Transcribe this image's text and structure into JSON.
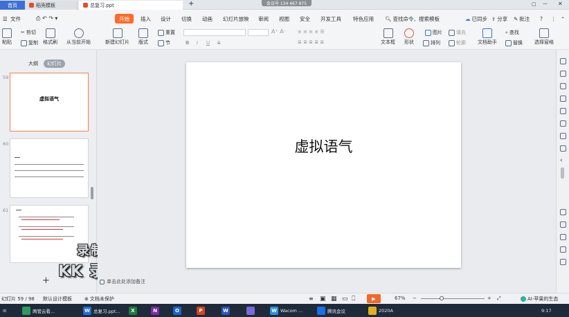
{
  "titlebar": {
    "tabs": [
      {
        "label": "首页",
        "active": true
      },
      {
        "label": "稻壳模板"
      },
      {
        "label": "总复习.ppt"
      }
    ],
    "new_tab": "+",
    "meeting_badge": "会议号 134 467 875",
    "window_controls": [
      "▢",
      "—",
      "✕"
    ]
  },
  "ribbon_tabs": {
    "file": "文件",
    "items": [
      "开始",
      "插入",
      "设计",
      "切换",
      "动画",
      "幻灯片放映",
      "审阅",
      "视图",
      "安全",
      "开发工具",
      "特色应用"
    ],
    "active": "开始",
    "search": "查找命令、搜索模板",
    "sync": "已同步",
    "share": "分享",
    "annotate": "批注",
    "help": "?"
  },
  "ribbon": {
    "paste": "粘贴",
    "cut": "剪切",
    "copy": "复制",
    "format_painter": "格式刷",
    "from_current": "从当前开始",
    "new_slide": "新建幻灯片",
    "layout": "版式",
    "reset": "重置",
    "section": "节",
    "text_box": "文本框",
    "shape": "形状",
    "arrange": "排列",
    "picture": "图片",
    "fill": "填充",
    "outline": "轮廓",
    "find": "查找",
    "replace": "替换",
    "text_tools": "文档助手",
    "select_pane": "选择窗格",
    "bold": "B",
    "italic": "I",
    "underline": "U",
    "strike": "S"
  },
  "left_panel": {
    "view_outline": "大纲",
    "view_slides": "幻灯片",
    "thumbnails": [
      {
        "num": "59",
        "title": "虚拟语气",
        "selected": true
      },
      {
        "num": "60",
        "title": ""
      },
      {
        "num": "61",
        "title": ""
      }
    ],
    "add": "+"
  },
  "slide": {
    "title": "虚拟语气"
  },
  "notes_hint": "单击此处添加备注",
  "watermark": {
    "line1": "录制工具",
    "line2": "KK 录像机"
  },
  "statusbar": {
    "slide_info": "幻灯片 59 / 98",
    "theme": "默认设计模板",
    "protect": "文档未保护",
    "zoom": "67%",
    "zoom_level": 0.33,
    "ai": "AI-苹果的生态"
  },
  "taskbar": {
    "items": [
      {
        "label": "两管云看...",
        "color": "#2e9b5e"
      },
      {
        "label": "总复习.ppt...",
        "color": "#1e6fd9"
      },
      {
        "label": "",
        "color": "#1d7a3e"
      },
      {
        "label": "",
        "color": "#7a2da0"
      },
      {
        "label": "",
        "color": "#1a66c9"
      },
      {
        "label": "",
        "color": "#d2461d"
      },
      {
        "label": "",
        "color": "#2b56b8"
      },
      {
        "label": "",
        "color": "#7a6ad9"
      },
      {
        "label": "Wacom ...",
        "color": "#2891e0"
      },
      {
        "label": "腾讯会议",
        "color": "#1a6fe8"
      },
      {
        "label": "2020A",
        "color": "#e0b020"
      }
    ],
    "clock": "9:17"
  },
  "colors": {
    "accent": "#ff6a2a",
    "home_tab": "#3d6fd6",
    "selected_thumb": "#f08050"
  }
}
